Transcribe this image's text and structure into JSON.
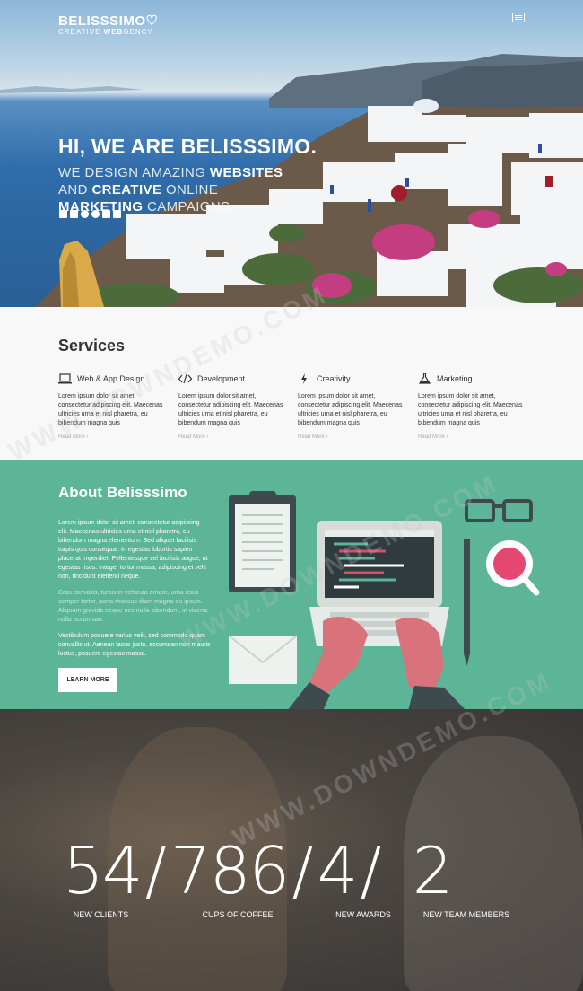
{
  "header": {
    "logo_main": "BELISSSIMO",
    "logo_heart": "♡",
    "logo_sub_pre": "CREATIVE ",
    "logo_sub_bold": "WEB",
    "logo_sub_post": "GENCY"
  },
  "hero": {
    "headline": "HI, WE ARE BELISSSIMO.",
    "line1_thin": "WE DESIGN AMAZING ",
    "line1_bold": "WEBSITES",
    "line2_thin": "AND ",
    "line2_bold": "CREATIVE",
    "line2_thin2": " ONLINE",
    "line3_bold": "MARKETING",
    "line3_thin": " CAMPAIGNS",
    "socials": [
      "facebook-icon",
      "twitter-icon",
      "pinterest-icon",
      "google-plus-icon",
      "instagram-icon",
      "vimeo-icon"
    ]
  },
  "services": {
    "title": "Services",
    "items": [
      {
        "title": "Web & App Design",
        "icon": "laptop-icon",
        "text": "Lorem ipsum dolor sit amet, consectetur adipiscing elit. Maecenas ultricies urna et nisl pharetra, eu bibendum magna quis",
        "more": "Read More ›"
      },
      {
        "title": "Development",
        "icon": "code-icon",
        "text": "Lorem ipsum dolor sit amet, consectetur adipiscing elit. Maecenas ultricies urna et nisl pharetra, eu bibendum magna quis",
        "more": "Read More ›"
      },
      {
        "title": "Creativity",
        "icon": "bolt-icon",
        "text": "Lorem ipsum dolor sit amet, consectetur adipiscing elit. Maecenas ultricies urna et nisl pharetra, eu bibendum magna quis",
        "more": "Read More ›"
      },
      {
        "title": "Marketing",
        "icon": "flask-icon",
        "text": "Lorem ipsum dolor sit amet, consectetur adipiscing elit. Maecenas ultricies urna et nisl pharetra, eu bibendum magna quis",
        "more": "Read More ›"
      }
    ]
  },
  "about": {
    "title": "About Belisssimo",
    "p1": "Lorem ipsum dolor sit amet, consectetur adipiscing elit. Maecenas ultricies urna et nisl pharetra, eu bibendum magna elementum. Sed aliquet facilisis turpis quis consequat. In egestas lobortis sapien placerat imperdiet. Pellentesque vel facilisis augue, ut egestas risus. Integer tortor massa, adipiscing et velit non, tincidunt eleifend neque.",
    "p2": "Cras convallis, turpis in vehicula ornare, urna risus semper tortor, porta rhoncus diam magna eu ipsum. Aliquam gravida neque nec nulla bibendum, in viverra nulla accumsan.",
    "p3": "Vestibulum posuere varius velit, sed commodo quam convallis ut. Aenean lacus justo, accumsan non mauris luctus, posuere egestas massa.",
    "button": "LEARN MORE"
  },
  "stats": {
    "items": [
      {
        "value": "54",
        "label": "NEW CLIENTS"
      },
      {
        "value": "786",
        "label": "CUPS OF COFFEE"
      },
      {
        "value": "4",
        "label": "NEW AWARDS"
      },
      {
        "value": "2",
        "label": "NEW TEAM MEMBERS"
      }
    ],
    "separator": "/"
  },
  "watermark": "WWW.DOWNDEMO.COM"
}
